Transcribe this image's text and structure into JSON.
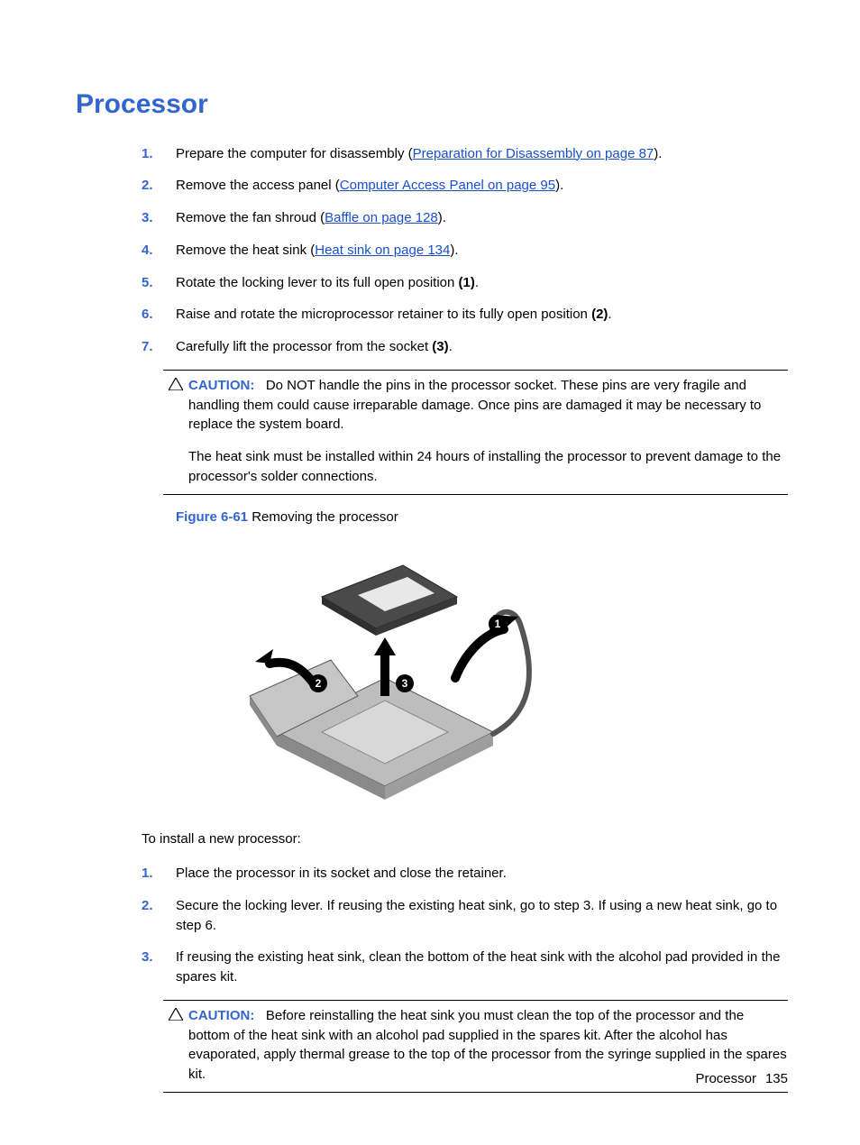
{
  "title": "Processor",
  "steps1": [
    {
      "n": "1.",
      "pre": "Prepare the computer for disassembly (",
      "link": "Preparation for Disassembly on page 87",
      "post": ")."
    },
    {
      "n": "2.",
      "pre": "Remove the access panel (",
      "link": "Computer Access Panel on page 95",
      "post": ")."
    },
    {
      "n": "3.",
      "pre": "Remove the fan shroud (",
      "link": "Baffle on page 128",
      "post": ")."
    },
    {
      "n": "4.",
      "pre": "Remove the heat sink (",
      "link": "Heat sink on page 134",
      "post": ")."
    },
    {
      "n": "5.",
      "text": "Rotate the locking lever to its full open position ",
      "bold": "(1)",
      "tail": "."
    },
    {
      "n": "6.",
      "text": "Raise and rotate the microprocessor retainer to its fully open position ",
      "bold": "(2)",
      "tail": "."
    },
    {
      "n": "7.",
      "text": "Carefully lift the processor from the socket ",
      "bold": "(3)",
      "tail": "."
    }
  ],
  "caution1": {
    "label": "CAUTION:",
    "p1": "Do NOT handle the pins in the processor socket. These pins are very fragile and handling them could cause irreparable damage. Once pins are damaged it may be necessary to replace the system board.",
    "p2": "The heat sink must be installed within 24 hours of installing the processor to prevent damage to the processor's solder connections."
  },
  "figure": {
    "num": "Figure 6-61",
    "caption": "  Removing the processor"
  },
  "callouts": {
    "c1": "1",
    "c2": "2",
    "c3": "3"
  },
  "intro2": "To install a new processor:",
  "steps2": [
    {
      "n": "1.",
      "text": "Place the processor in its socket and close the retainer."
    },
    {
      "n": "2.",
      "text": "Secure the locking lever. If reusing the existing heat sink, go to step 3. If using a new heat sink, go to step 6."
    },
    {
      "n": "3.",
      "text": "If reusing the existing heat sink, clean the bottom of the heat sink with the alcohol pad provided in the spares kit."
    }
  ],
  "caution2": {
    "label": "CAUTION:",
    "p1": "Before reinstalling the heat sink you must clean the top of the processor and the bottom of the heat sink with an alcohol pad supplied in the spares kit. After the alcohol has evaporated, apply thermal grease to the top of the processor from the syringe supplied in the spares kit."
  },
  "footer": {
    "section": "Processor",
    "page": "135"
  }
}
